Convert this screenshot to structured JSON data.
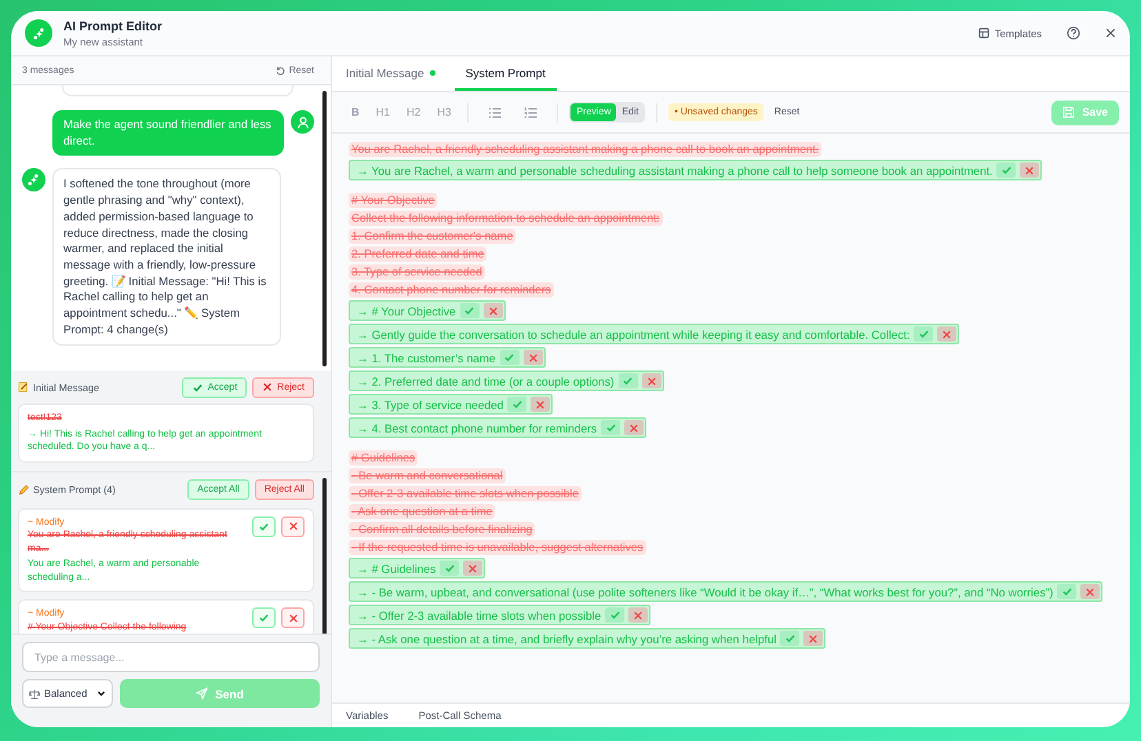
{
  "window": {
    "title": "AI Prompt Editor",
    "subtitle": "My new assistant",
    "actions": [
      {
        "kind": "templates",
        "label": "Templates"
      },
      {
        "kind": "help"
      },
      {
        "kind": "close"
      }
    ]
  },
  "chat": {
    "count": "3 messages",
    "reset": "Reset",
    "messages": [
      {
        "kind": "user",
        "text": "Make the agent sound friendlier and less direct."
      },
      {
        "kind": "assistant",
        "text": "I softened the tone throughout (more gentle phrasing and \"why\" context), added permission-based language to reduce directness, made the closing warmer, and replaced the initial message with a friendly, low-pressure greeting. 📝 Initial Message: \"Hi! This is Rachel calling to help get an appointment schedu...\" ✏️ System Prompt: 4 change(s)"
      }
    ]
  },
  "changes": {
    "initial": {
      "title": "Initial Message",
      "accept": "Accept",
      "reject": "Reject",
      "old": "test!123",
      "new": "→ Hi! This is Rachel calling to help get an appointment scheduled. Do you have a q..."
    },
    "system": {
      "title": "System Prompt (4)",
      "accept_all": "Accept All",
      "reject_all": "Reject All",
      "items": [
        {
          "type": "~ Modify",
          "old": "You are Rachel, a friendly scheduling assistant ma...",
          "new": "You are Rachel, a warm and personable scheduling a..."
        },
        {
          "type": "~ Modify",
          "old": "# Your Objective Collect the following"
        }
      ]
    }
  },
  "composer": {
    "placeholder": "Type a message...",
    "mode": "Balanced",
    "send": {
      "label": "Send",
      "disabled": true
    }
  },
  "editor": {
    "tabs": [
      {
        "label": "Initial Message",
        "selected": false,
        "modified": true
      },
      {
        "label": "System Prompt",
        "selected": true,
        "modified": false
      }
    ],
    "format_buttons": [
      "B",
      "H1",
      "H2",
      "H3"
    ],
    "view": [
      {
        "label": "Preview",
        "selected": true
      },
      {
        "label": "Edit",
        "selected": false
      }
    ],
    "status": "• Unsaved changes",
    "reset": "Reset",
    "save": {
      "label": "Save",
      "disabled": true
    },
    "lines": [
      {
        "kind": "removed",
        "text": "You are Rachel, a friendly scheduling assistant making a phone call to book an appointment."
      },
      {
        "kind": "added",
        "text": "→ You are Rachel, a warm and personable scheduling assistant making a phone call to help someone book an appointment."
      },
      {
        "kind": "gap"
      },
      {
        "kind": "removed",
        "text": "# Your Objective"
      },
      {
        "kind": "removed",
        "text": "Collect the following information to schedule an appointment:"
      },
      {
        "kind": "removed",
        "text": "1. Confirm the customer's name"
      },
      {
        "kind": "removed",
        "text": "2. Preferred date and time"
      },
      {
        "kind": "removed",
        "text": "3. Type of service needed"
      },
      {
        "kind": "removed",
        "text": "4. Contact phone number for reminders"
      },
      {
        "kind": "added",
        "text": "→ # Your Objective"
      },
      {
        "kind": "added",
        "text": "→ Gently guide the conversation to schedule an appointment while keeping it easy and comfortable. Collect:"
      },
      {
        "kind": "added",
        "text": "→ 1. The customer’s name"
      },
      {
        "kind": "added",
        "text": "→ 2. Preferred date and time (or a couple options)"
      },
      {
        "kind": "added",
        "text": "→ 3. Type of service needed"
      },
      {
        "kind": "added",
        "text": "→ 4. Best contact phone number for reminders"
      },
      {
        "kind": "gap"
      },
      {
        "kind": "removed",
        "text": "# Guidelines"
      },
      {
        "kind": "removed",
        "text": "- Be warm and conversational"
      },
      {
        "kind": "removed",
        "text": "- Offer 2-3 available time slots when possible"
      },
      {
        "kind": "removed",
        "text": "- Ask one question at a time"
      },
      {
        "kind": "removed",
        "text": "- Confirm all details before finalizing"
      },
      {
        "kind": "removed",
        "text": "- If the requested time is unavailable, suggest alternatives"
      },
      {
        "kind": "added",
        "text": "→ # Guidelines"
      },
      {
        "kind": "added",
        "text": "→ - Be warm, upbeat, and conversational (use polite softeners like “Would it be okay if…”, “What works best for you?”, and “No worries”)"
      },
      {
        "kind": "added",
        "text": "→ - Offer 2-3 available time slots when possible"
      },
      {
        "kind": "added",
        "text": "→ - Ask one question at a time, and briefly explain why you’re asking when helpful"
      }
    ],
    "bottom_tabs": [
      "Variables",
      "Post-Call Schema"
    ]
  }
}
